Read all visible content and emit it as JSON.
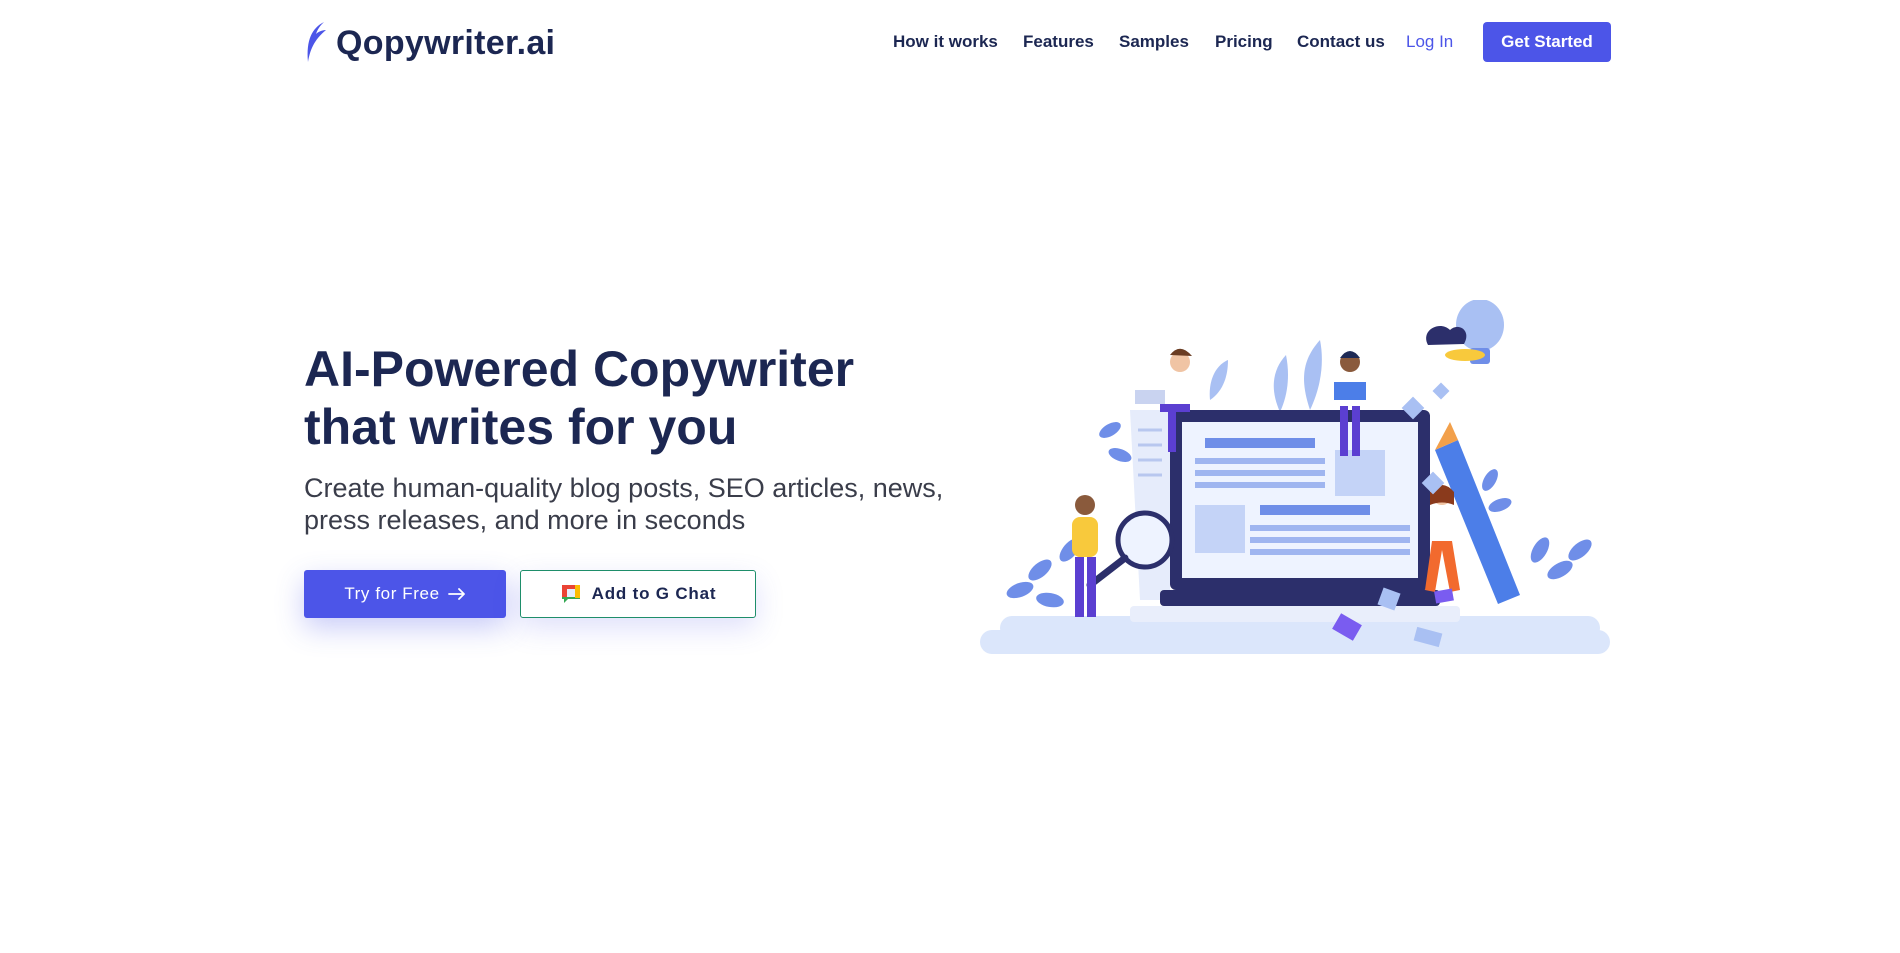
{
  "brand": {
    "name": "Qopywriter.ai",
    "color": "#4c55e8",
    "text_color": "#1c2752"
  },
  "nav": {
    "items": [
      {
        "label": "How it works"
      },
      {
        "label": "Features"
      },
      {
        "label": "Samples"
      },
      {
        "label": "Pricing"
      },
      {
        "label": "Contact us"
      }
    ],
    "login_label": "Log In",
    "cta_label": "Get Started"
  },
  "hero": {
    "title_line1": "AI-Powered Copywriter",
    "title_line2": "that writes for you",
    "subtitle_line1": "Create human-quality blog posts, SEO articles, news,",
    "subtitle_line2": "press releases, and more in seconds",
    "primary_button": {
      "label": "Try for Free",
      "icon": "arrow-right-icon"
    },
    "secondary_button": {
      "label": "Add to G Chat",
      "icon": "google-chat-icon"
    }
  },
  "illustration": {
    "icon": "laptop-team-illustration"
  }
}
